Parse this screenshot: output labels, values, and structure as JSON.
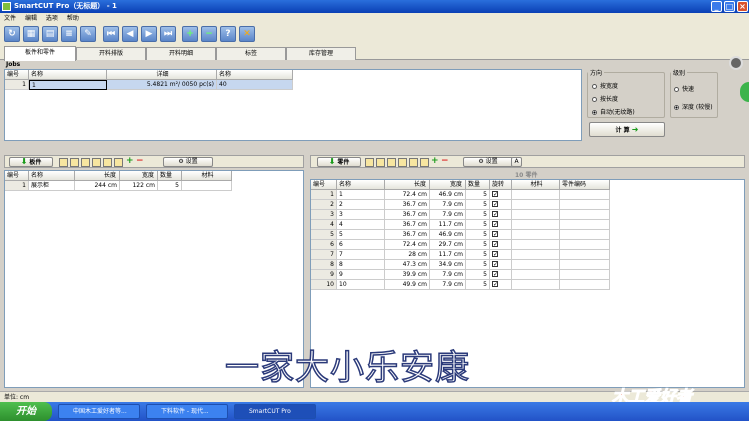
{
  "window": {
    "title": "SmartCUT Pro（无标题） - 1",
    "min": "_",
    "max": "□",
    "close": "×"
  },
  "menu": [
    "文件",
    "编辑",
    "选项",
    "帮助"
  ],
  "tabs": [
    "板件和零件",
    "开料排版",
    "开料明细",
    "标签",
    "库存管理"
  ],
  "jobs": {
    "label": "Jobs",
    "headers": [
      "编号",
      "名称",
      "详细",
      "名称"
    ],
    "row": {
      "num": "1",
      "name": "1",
      "detail": "5.4821 m²/ 0050 pc(s)",
      "name2": "40"
    }
  },
  "direction": {
    "legend": "方向",
    "options": [
      "按宽度",
      "按长度",
      "自动(无纹路)"
    ],
    "selected": 2
  },
  "level": {
    "legend": "级别",
    "options": [
      "快速",
      "深度 (较慢)"
    ],
    "selected": 1
  },
  "calc_button": "计 算",
  "boards": {
    "title": "板件",
    "settings": "设置",
    "headers": [
      "编号",
      "名称",
      "长度",
      "宽度",
      "数量",
      "材料"
    ],
    "rows": [
      {
        "num": "1",
        "name": "展示柜",
        "length": "244 cm",
        "width": "122 cm",
        "qty": "5",
        "mat": ""
      }
    ]
  },
  "parts": {
    "title": "零件",
    "settings": "设置",
    "count": "10 零件",
    "headers": [
      "编号",
      "名称",
      "长度",
      "宽度",
      "数量",
      "旋转",
      "材料",
      "零件编码"
    ],
    "rows": [
      {
        "num": "1",
        "name": "1",
        "length": "72.4 cm",
        "width": "46.9 cm",
        "qty": "5",
        "rot": "✓"
      },
      {
        "num": "2",
        "name": "2",
        "length": "36.7 cm",
        "width": "7.9 cm",
        "qty": "5",
        "rot": "✓"
      },
      {
        "num": "3",
        "name": "3",
        "length": "36.7 cm",
        "width": "7.9 cm",
        "qty": "5",
        "rot": "✓"
      },
      {
        "num": "4",
        "name": "4",
        "length": "36.7 cm",
        "width": "11.7 cm",
        "qty": "5",
        "rot": "✓"
      },
      {
        "num": "5",
        "name": "5",
        "length": "36.7 cm",
        "width": "46.9 cm",
        "qty": "5",
        "rot": "✓"
      },
      {
        "num": "6",
        "name": "6",
        "length": "72.4 cm",
        "width": "29.7 cm",
        "qty": "5",
        "rot": "✓"
      },
      {
        "num": "7",
        "name": "7",
        "length": "28 cm",
        "width": "11.7 cm",
        "qty": "5",
        "rot": "✓"
      },
      {
        "num": "8",
        "name": "8",
        "length": "47.3 cm",
        "width": "34.9 cm",
        "qty": "5",
        "rot": "✓"
      },
      {
        "num": "9",
        "name": "9",
        "length": "39.9 cm",
        "width": "7.9 cm",
        "qty": "5",
        "rot": "✓"
      },
      {
        "num": "10",
        "name": "10",
        "length": "49.9 cm",
        "width": "7.9 cm",
        "qty": "5",
        "rot": "✓"
      }
    ]
  },
  "watermark": "一家大小乐安康",
  "status": "单位: cm",
  "taskbar": {
    "start": "开始",
    "items": [
      "中国木工爱好者等...",
      "下料软件 - 现代...",
      "SmartCUT Pro"
    ]
  },
  "logo": "木工爱好者",
  "colors": {
    "title_bar": "#0a3fb4",
    "selected_row": "#c6d7ef",
    "accent_green": "#1a9b1a"
  }
}
